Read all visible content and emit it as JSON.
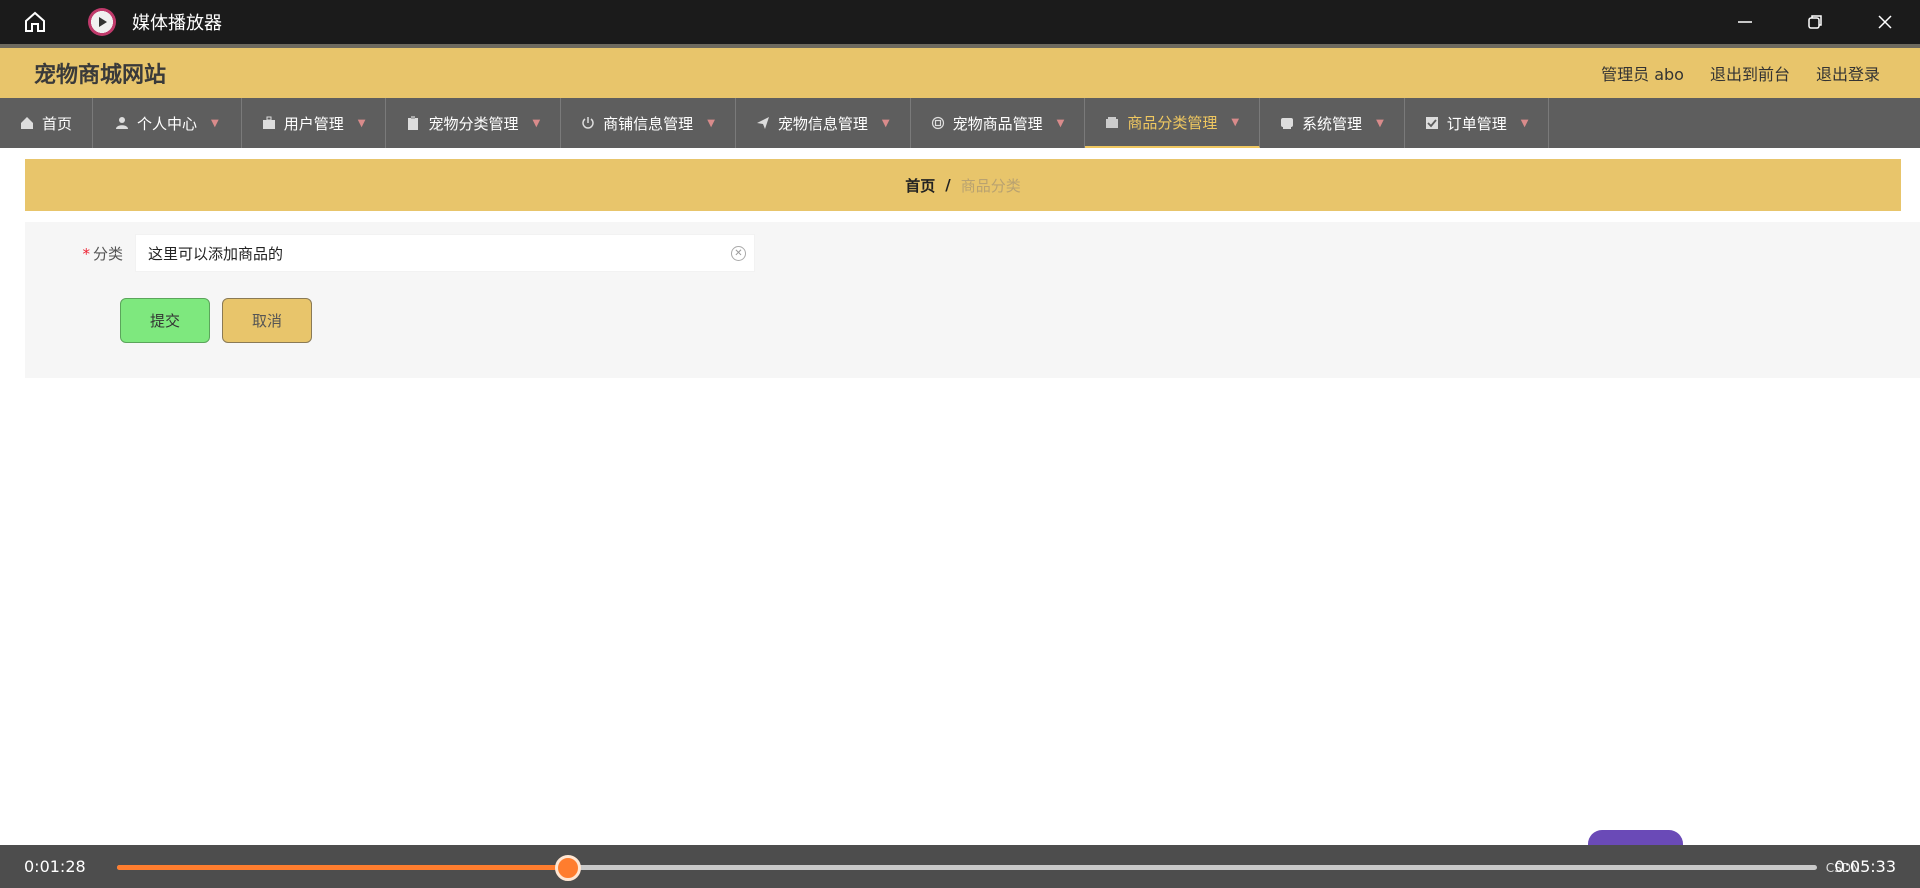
{
  "player": {
    "title": "媒体播放器",
    "time_current": "0:01:28",
    "time_total": "0:05:33",
    "watermark": "CSDN",
    "progress": 0.265,
    "accent": "#ff7d2e"
  },
  "site": {
    "title": "宠物商城网站",
    "admin_label": "管理员 abo",
    "to_front": "退出到前台",
    "logout": "退出登录"
  },
  "nav": {
    "items": [
      {
        "label": "首页",
        "icon": "home-icon"
      },
      {
        "label": "个人中心",
        "icon": "user-icon"
      },
      {
        "label": "用户管理",
        "icon": "briefcase-icon"
      },
      {
        "label": "宠物分类管理",
        "icon": "clipboard-icon"
      },
      {
        "label": "商铺信息管理",
        "icon": "power-icon"
      },
      {
        "label": "宠物信息管理",
        "icon": "send-icon"
      },
      {
        "label": "宠物商品管理",
        "icon": "cpu-icon"
      },
      {
        "label": "商品分类管理",
        "icon": "wallet-icon"
      },
      {
        "label": "系统管理",
        "icon": "box-icon"
      },
      {
        "label": "订单管理",
        "icon": "check-icon"
      }
    ],
    "active_index": 7
  },
  "breadcrumb": {
    "home": "首页",
    "sep": "/",
    "current": "商品分类"
  },
  "form": {
    "label": "分类",
    "required_mark": "*",
    "value": "这里可以添加商品的",
    "submit": "提交",
    "cancel": "取消"
  }
}
